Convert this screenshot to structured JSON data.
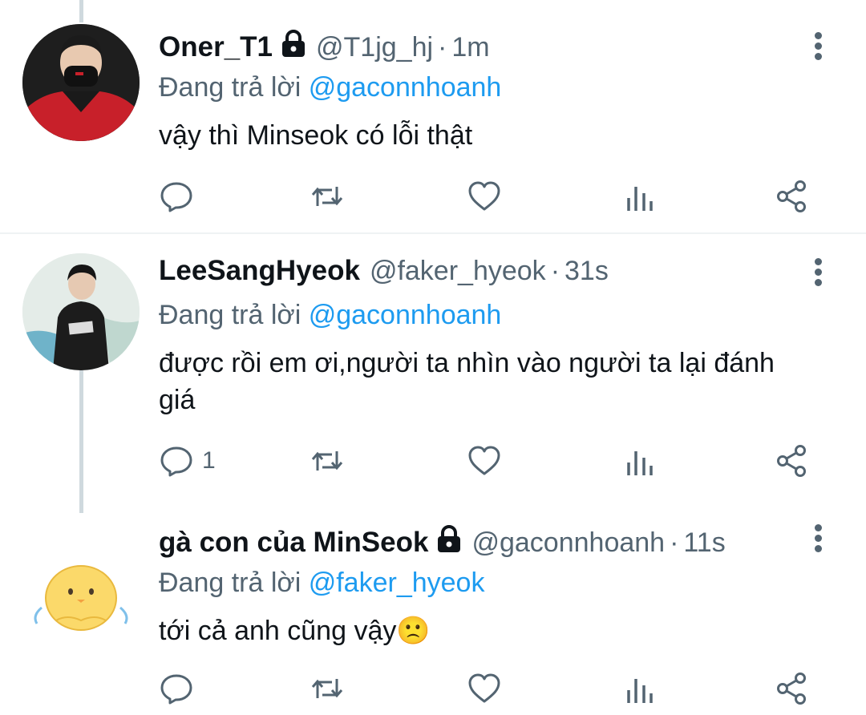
{
  "tweets": [
    {
      "name": "Oner_T1",
      "handle": "@T1jg_hj",
      "separator": "·",
      "time": "1m",
      "reply_prefix": "Đang trả lời",
      "reply_to": "@gaconnhoanh",
      "text": "vậy thì Minseok có lỗi thật",
      "reply_count": ""
    },
    {
      "name": "LeeSangHyeok",
      "handle": "@faker_hyeok",
      "separator": "·",
      "time": "31s",
      "reply_prefix": "Đang trả lời",
      "reply_to": "@gaconnhoanh",
      "text": "được rồi em ơi,người ta nhìn vào người ta lại đánh giá",
      "reply_count": "1"
    },
    {
      "name": "gà con của MinSeok",
      "handle": "@gaconnhoanh",
      "separator": "·",
      "time": "11s",
      "reply_prefix": "Đang trả lời",
      "reply_to": "@faker_hyeok",
      "text": "tới cả anh cũng vậy🙁",
      "reply_count": ""
    }
  ],
  "colors": {
    "accent": "#1d9bf0",
    "secondary_text": "#536471",
    "primary_text": "#0f1419",
    "divider": "#eff3f4",
    "thread_line": "#cfd9de"
  },
  "icons": [
    "reply-icon",
    "retweet-icon",
    "like-icon",
    "analytics-icon",
    "share-icon",
    "lock-icon",
    "more-icon"
  ]
}
